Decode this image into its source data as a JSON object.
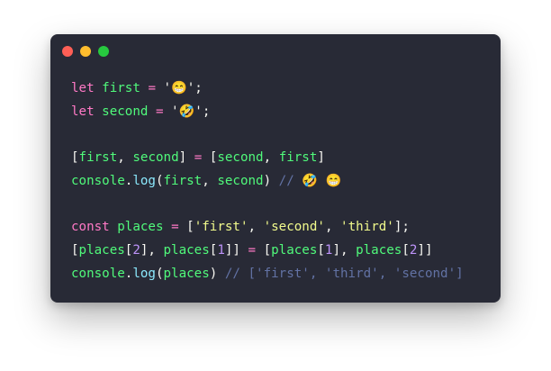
{
  "colors": {
    "background": "#282a36",
    "keyword": "#ff79c6",
    "variable": "#50fa7b",
    "string": "#f1fa8c",
    "number": "#bd93f9",
    "function": "#8be9fd",
    "comment": "#6272a4",
    "plain": "#f8f8f2"
  },
  "window_controls": [
    "close-dot",
    "minimize-dot",
    "zoom-dot"
  ],
  "code": {
    "lines": [
      [
        {
          "t": "let",
          "c": "kw"
        },
        {
          "t": " ",
          "c": "punc"
        },
        {
          "t": "first",
          "c": "var"
        },
        {
          "t": " ",
          "c": "punc"
        },
        {
          "t": "=",
          "c": "op"
        },
        {
          "t": " '",
          "c": "punc"
        },
        {
          "t": "😁",
          "c": "str"
        },
        {
          "t": "';",
          "c": "punc"
        }
      ],
      [
        {
          "t": "let",
          "c": "kw"
        },
        {
          "t": " ",
          "c": "punc"
        },
        {
          "t": "second",
          "c": "var"
        },
        {
          "t": " ",
          "c": "punc"
        },
        {
          "t": "=",
          "c": "op"
        },
        {
          "t": " '",
          "c": "punc"
        },
        {
          "t": "🤣",
          "c": "str"
        },
        {
          "t": "';",
          "c": "punc"
        }
      ],
      [],
      [
        {
          "t": "[",
          "c": "punc"
        },
        {
          "t": "first",
          "c": "var"
        },
        {
          "t": ", ",
          "c": "punc"
        },
        {
          "t": "second",
          "c": "var"
        },
        {
          "t": "] ",
          "c": "punc"
        },
        {
          "t": "=",
          "c": "op"
        },
        {
          "t": " [",
          "c": "punc"
        },
        {
          "t": "second",
          "c": "var"
        },
        {
          "t": ", ",
          "c": "punc"
        },
        {
          "t": "first",
          "c": "var"
        },
        {
          "t": "]",
          "c": "punc"
        }
      ],
      [
        {
          "t": "console",
          "c": "var"
        },
        {
          "t": ".",
          "c": "punc"
        },
        {
          "t": "log",
          "c": "fn"
        },
        {
          "t": "(",
          "c": "punc"
        },
        {
          "t": "first",
          "c": "var"
        },
        {
          "t": ", ",
          "c": "punc"
        },
        {
          "t": "second",
          "c": "var"
        },
        {
          "t": ") ",
          "c": "punc"
        },
        {
          "t": "// 🤣 😁",
          "c": "cmt"
        }
      ],
      [],
      [
        {
          "t": "const",
          "c": "kw"
        },
        {
          "t": " ",
          "c": "punc"
        },
        {
          "t": "places",
          "c": "var"
        },
        {
          "t": " ",
          "c": "punc"
        },
        {
          "t": "=",
          "c": "op"
        },
        {
          "t": " [",
          "c": "punc"
        },
        {
          "t": "'first'",
          "c": "str"
        },
        {
          "t": ", ",
          "c": "punc"
        },
        {
          "t": "'second'",
          "c": "str"
        },
        {
          "t": ", ",
          "c": "punc"
        },
        {
          "t": "'third'",
          "c": "str"
        },
        {
          "t": "];",
          "c": "punc"
        }
      ],
      [
        {
          "t": "[",
          "c": "punc"
        },
        {
          "t": "places",
          "c": "var"
        },
        {
          "t": "[",
          "c": "punc"
        },
        {
          "t": "2",
          "c": "num"
        },
        {
          "t": "], ",
          "c": "punc"
        },
        {
          "t": "places",
          "c": "var"
        },
        {
          "t": "[",
          "c": "punc"
        },
        {
          "t": "1",
          "c": "num"
        },
        {
          "t": "]] ",
          "c": "punc"
        },
        {
          "t": "=",
          "c": "op"
        },
        {
          "t": " [",
          "c": "punc"
        },
        {
          "t": "places",
          "c": "var"
        },
        {
          "t": "[",
          "c": "punc"
        },
        {
          "t": "1",
          "c": "num"
        },
        {
          "t": "], ",
          "c": "punc"
        },
        {
          "t": "places",
          "c": "var"
        },
        {
          "t": "[",
          "c": "punc"
        },
        {
          "t": "2",
          "c": "num"
        },
        {
          "t": "]]",
          "c": "punc"
        }
      ],
      [
        {
          "t": "console",
          "c": "var"
        },
        {
          "t": ".",
          "c": "punc"
        },
        {
          "t": "log",
          "c": "fn"
        },
        {
          "t": "(",
          "c": "punc"
        },
        {
          "t": "places",
          "c": "var"
        },
        {
          "t": ") ",
          "c": "punc"
        },
        {
          "t": "// ['first', 'third', 'second']",
          "c": "cmt"
        }
      ]
    ]
  }
}
